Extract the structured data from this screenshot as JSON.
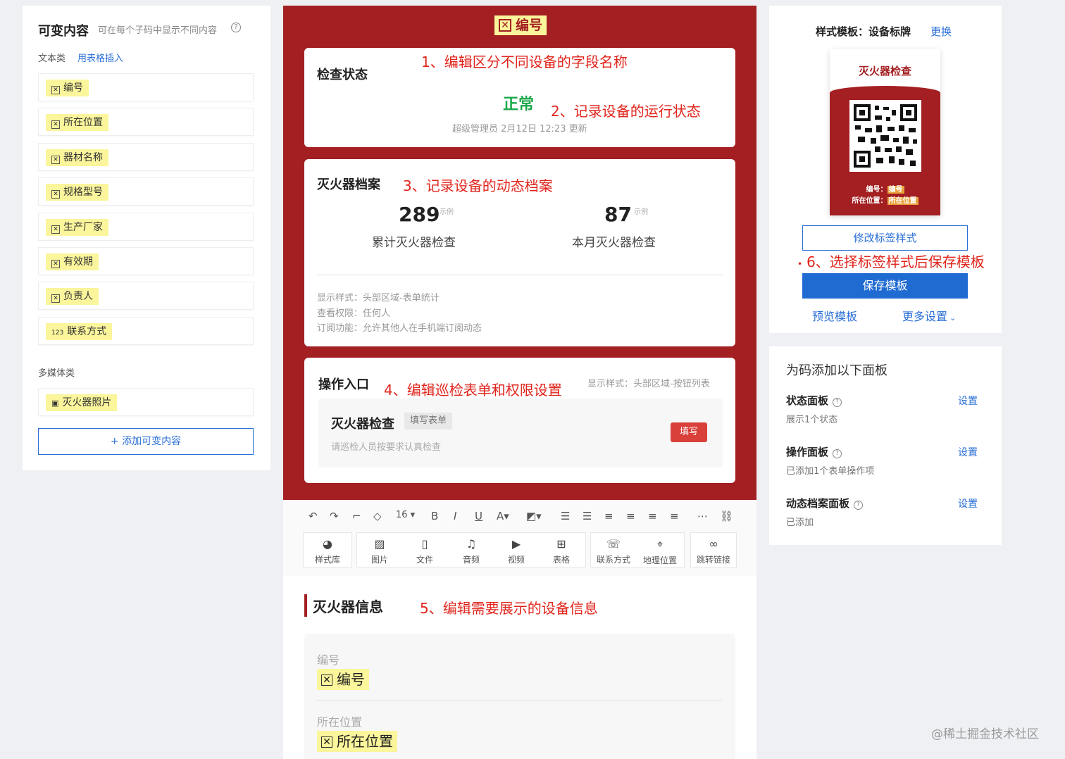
{
  "left": {
    "title": "可变内容",
    "subtitle": "可在每个子码中显示不同内容",
    "help_glyph": "?",
    "text_section": "文本类",
    "text_link": "用表格插入",
    "text_items": [
      "编号",
      "所在位置",
      "器材名称",
      "规格型号",
      "生产厂家",
      "有效期",
      "负责人",
      "联系方式"
    ],
    "media_section": "多媒体类",
    "media_items": [
      "灭火器照片"
    ],
    "add_button": "+ 添加可变内容"
  },
  "center": {
    "header_chip": "编号",
    "status_card": {
      "title": "检查状态",
      "value": "正常",
      "meta": "超级管理员 2月12日 12:23 更新",
      "anno1": "1、编辑区分不同设备的字段名称",
      "anno2": "2、记录设备的运行状态"
    },
    "archive_card": {
      "title": "灭火器档案",
      "anno": "3、记录设备的动态档案",
      "stat1_value": "289",
      "stat1_tag": "示例",
      "stat1_label": "累计灭火器检查",
      "stat2_value": "87",
      "stat2_tag": "示例",
      "stat2_label": "本月灭火器检查",
      "line1": "显示样式：头部区域-表单统计",
      "line2": "查看权限：任何人",
      "line3": "订阅功能：允许其他人在手机端订阅动态"
    },
    "action_card": {
      "title": "操作入口",
      "anno": "4、编辑巡检表单和权限设置",
      "style_note": "显示样式：头部区域-按钮列表",
      "form_name": "灭火器检查",
      "form_tag": "填写表单",
      "form_desc": "请巡检人员按要求认真检查",
      "fill_button": "填写"
    },
    "toolbar": {
      "font_size": "16",
      "tools": [
        "样式库",
        "图片",
        "文件",
        "音频",
        "视频",
        "表格",
        "联系方式",
        "地理位置",
        "跳转链接"
      ]
    },
    "info_section": {
      "title": "灭火器信息",
      "anno": "5、编辑需要展示的设备信息",
      "field1_label": "编号",
      "field1_value": "编号",
      "field2_label": "所在位置",
      "field2_value": "所在位置"
    }
  },
  "right_top": {
    "title": "样式模板：设备标牌",
    "change_link": "更换",
    "tag_title": "灭火器检查",
    "tag_line1_label": "编号：",
    "tag_line1_value": "编号",
    "tag_line2_label": "所在位置：",
    "tag_line2_value": "所在位置",
    "modify_button": "修改标签样式",
    "anno": "6、选择标签样式后保存模板",
    "save_button": "保存模板",
    "preview_link": "预览模板",
    "more_link": "更多设置"
  },
  "right_bottom": {
    "title": "为码添加以下面板",
    "rows": [
      {
        "title": "状态面板",
        "sub": "展示1个状态",
        "link": "设置"
      },
      {
        "title": "操作面板",
        "sub": "已添加1个表单操作项",
        "link": "设置"
      },
      {
        "title": "动态档案面板",
        "sub": "已添加",
        "link": "设置"
      }
    ]
  },
  "watermark": "@稀土掘金技术社区"
}
